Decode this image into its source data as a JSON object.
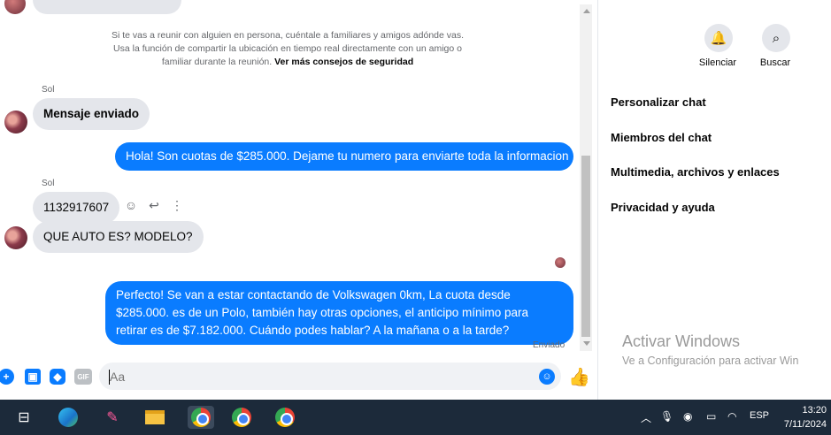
{
  "chat": {
    "safety_notice": "Si te vas a reunir con alguien en persona, cuéntale a familiares y amigos adónde vas. Usa la función de compartir la ubicación en tiempo real directamente con un amigo o familiar durante la reunión.",
    "safety_link": "Ver más consejos de seguridad",
    "messages": [
      {
        "sender": "Sol",
        "text": "Mensaje enviado"
      },
      {
        "text": "Hola! Son cuotas de $285.000. Dejame tu numero para enviarte toda la informacion"
      },
      {
        "sender": "Sol",
        "text": "1132917607"
      },
      {
        "text": "QUE AUTO ES? MODELO?"
      },
      {
        "text": "Perfecto!  Se van a estar contactando de Volkswagen 0km, La cuota desde $285.000. es de un Polo, también hay otras opciones, el anticipo mínimo para retirar es de $7.182.000. Cuándo podes hablar? A la mañana o a la tarde?"
      }
    ],
    "status": "Enviado"
  },
  "composer": {
    "placeholder": "Aa",
    "gif_label": "GIF"
  },
  "panel": {
    "mute_label": "Silenciar",
    "search_label": "Buscar",
    "menu": [
      "Personalizar chat",
      "Miembros del chat",
      "Multimedia, archivos y enlaces",
      "Privacidad y ayuda"
    ],
    "watermark_title": "Activar Windows",
    "watermark_sub": "Ve a Configuración para activar Win"
  },
  "taskbar": {
    "lang": "ESP",
    "time": "13:20",
    "date": "7/11/2024"
  },
  "colors": {
    "accent": "#0a7cff",
    "incoming_bubble": "#e4e6eb",
    "taskbar": "#1c2a3a"
  }
}
